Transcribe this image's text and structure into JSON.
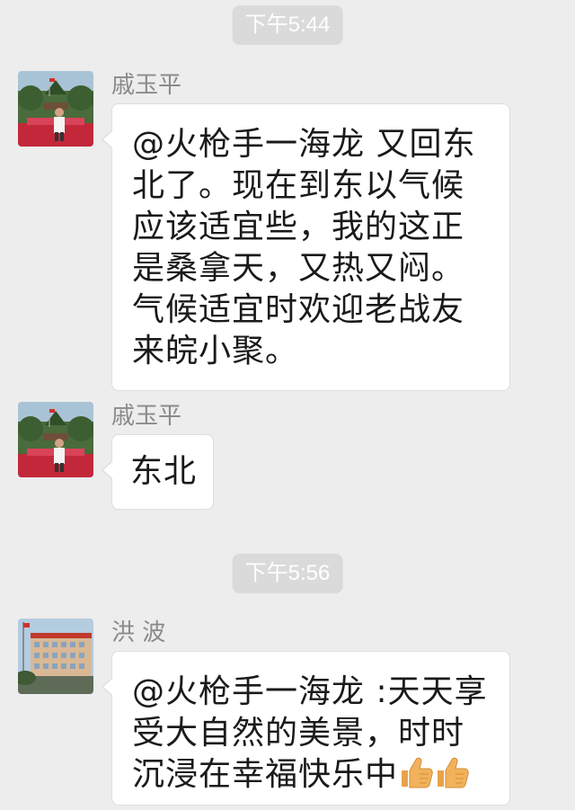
{
  "chat": {
    "timestamps": [
      "下午5:44",
      "下午5:56"
    ],
    "messages": [
      {
        "sender": "戚玉平",
        "text": "@火枪手一海龙 又回东北了。现在到东以气候应该适宜些，我的这正是桑拿天，又热又闷。气候适宜时欢迎老战友来皖小聚。"
      },
      {
        "sender": "戚玉平",
        "text": "东北"
      },
      {
        "sender": "洪 波",
        "text": "@火枪手一海龙 :天天享受大自然的美景，时时沉浸在幸福快乐中",
        "trailing_icons": [
          "thumbs-up-icon",
          "thumbs-up-icon"
        ]
      }
    ]
  },
  "colors": {
    "background": "#ededed",
    "bubble": "#ffffff",
    "timestamp_pill": "#dadada",
    "sender_name": "#8a8a8a",
    "thumbs_up": "#f2b25c"
  }
}
